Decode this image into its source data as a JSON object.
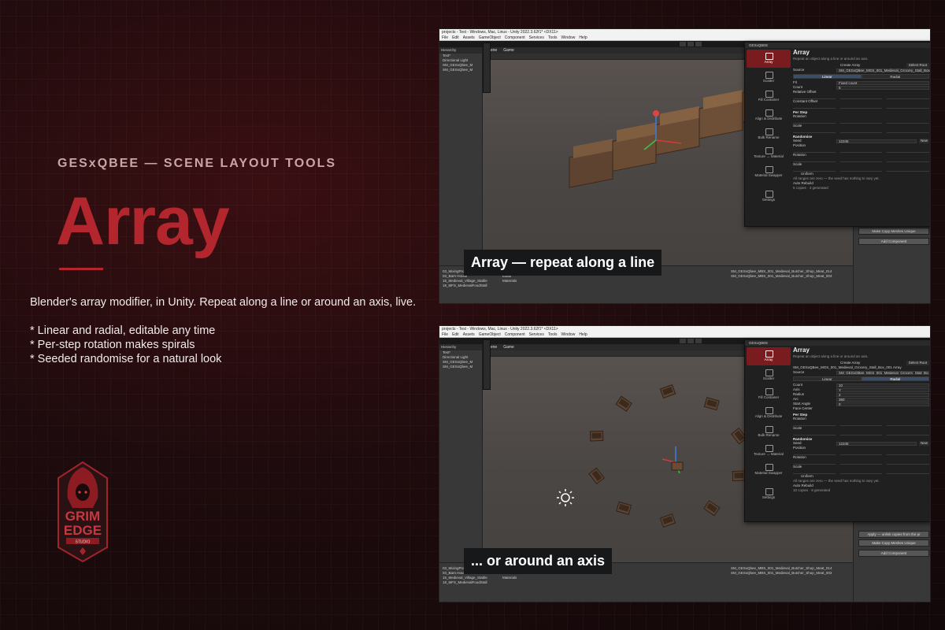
{
  "brand": {
    "eyebrow": "GESxQBEE — SCENE LAYOUT TOOLS",
    "title": "Array",
    "tagline": "Blender's array modifier, in Unity. Repeat along a line or around an axis, live.",
    "bullets": [
      "* Linear and radial, editable any time",
      "* Per-step rotation makes spirals",
      "* Seeded randomise for a natural look"
    ],
    "logo": {
      "line1": "GRIM",
      "line2": "EDGE",
      "line3": "STUDIO"
    },
    "accent": "#b3262d"
  },
  "unity": {
    "window_title": "projects - Test - Windows, Mac, Linux - Unity 2022.3.62f1* <DX11>",
    "menu": [
      "File",
      "Edit",
      "Assets",
      "GameObject",
      "Component",
      "Services",
      "Tools",
      "Window",
      "Help"
    ],
    "hierarchy_title": "Hierarchy",
    "hierarchy_items": [
      "Test*",
      "Directional Light",
      "SM_GESxQbee_M",
      "SM_GESxQbee_M"
    ],
    "scene_tabs": [
      "Scene",
      "Game"
    ],
    "project_items": [
      "03_MixingProps(v)t-01",
      "03_Barn House",
      "15_Medieval_Village_Stable",
      "18_MFS_MedievalFoodStall",
      "16_Alchemy_Workshop"
    ],
    "assets_items": [
      "Documentation",
      "Editor",
      "Materials"
    ],
    "right_items": [
      "SM_GESxQbee_MBS_001_Medieval_Butcher_Shop_Meat_014",
      "SM_GESxQbee_MBS_001_Medieval_Butcher_Shop_Meat_003"
    ],
    "inspector_buttons": [
      "Make Copy Meshes Unique",
      "Add Component"
    ],
    "inspector_buttons_2": [
      "Apply — unlink copies from the pr",
      "Make Copy Meshes Unique",
      "Add Component"
    ]
  },
  "tool": {
    "window_title": "GESxQBEE",
    "nav": [
      "Array",
      "Scatter",
      "Fill Container",
      "Align & Distribute",
      "Bulk Rename",
      "Texture → Material",
      "Material Swapper",
      "Settings"
    ],
    "panel_title": "Array",
    "panel_sub": "Repeat an object along a line or around an axis.",
    "create_label": "Create Array",
    "select_root": "Select Root",
    "source_label": "Source",
    "source_value": "SM_GESxQBee_MGS_001_Medieval_Grocery_Stall_Box",
    "modes": [
      "Linear",
      "Radial"
    ],
    "linear": {
      "fields": [
        "Fit",
        "Count",
        "Relative Offset",
        "Constant Offset"
      ],
      "fit_value": "Fixed count",
      "count_value": "5",
      "per_step": "Per Step",
      "rotation": "Rotation",
      "scale": "Scale",
      "randomise": "Randomise",
      "seed_label": "Seed",
      "seed_value": "12345",
      "new_label": "New",
      "position": "Position",
      "uniform": "Uniform",
      "note": "All ranges are zero — the seed has nothing to vary yet.",
      "auto_rebuild": "Auto Rebuild",
      "status": "5 copies · 4 generated"
    },
    "radial": {
      "heading": "SM_GESxQBee_MGS_001_Medieval_Grocery_Stall_Box_001 Array",
      "fields": [
        "Count",
        "Axis",
        "Radius",
        "Arc",
        "Start Angle",
        "Face Center"
      ],
      "values": [
        "10",
        "Y",
        "2",
        "360",
        "0",
        ""
      ],
      "status": "10 copies · 9 generated"
    }
  },
  "captions": {
    "top": "Array — repeat along a line",
    "bottom": "... or around an axis"
  }
}
